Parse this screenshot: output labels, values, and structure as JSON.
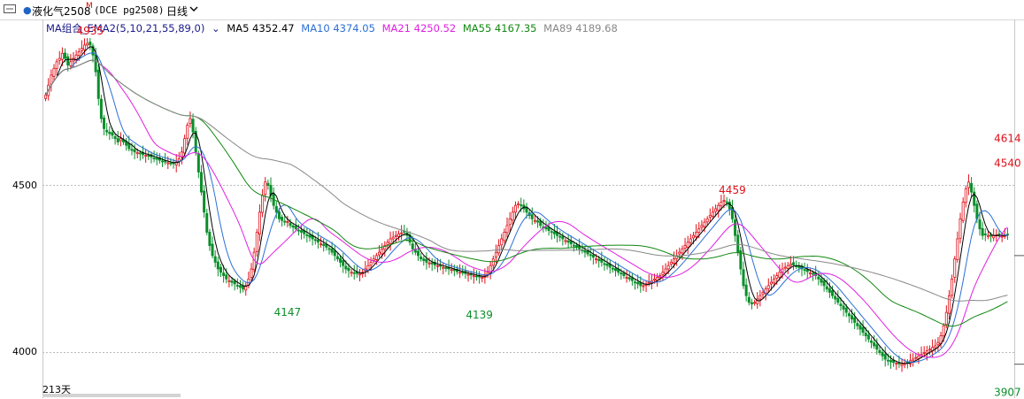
{
  "topbar": {
    "symbol": "液化气2508",
    "superscript": "M",
    "code": "(DCE pg2508)",
    "period": "日线"
  },
  "legend": {
    "name": "MA组合_EMA2(5,10,21,55,89,0)",
    "items": [
      {
        "label": "MA5 4352.47",
        "color": "#000000"
      },
      {
        "label": "MA10 4374.05",
        "color": "#2b6fd6"
      },
      {
        "label": "MA21 4250.52",
        "color": "#e11fe1"
      },
      {
        "label": "MA55 4167.35",
        "color": "#118811"
      },
      {
        "label": "MA89 4189.68",
        "color": "#888888"
      }
    ]
  },
  "footer": {
    "days": "213天"
  },
  "colors": {
    "up": "#e0101a",
    "down": "#0a8f2a",
    "grid": "#bbbbbb"
  },
  "chart_data": {
    "type": "candlestick",
    "ylim": [
      3890,
      4970
    ],
    "yticks": [
      4000,
      4500
    ],
    "annotations": [
      {
        "label": "4935",
        "i": 16,
        "value": 4935,
        "pos": "above",
        "color": "#e0101a"
      },
      {
        "label": "4147",
        "i": 87,
        "value": 4147,
        "pos": "below",
        "color": "#0a8f2a"
      },
      {
        "label": "4139",
        "i": 156,
        "value": 4139,
        "pos": "below",
        "color": "#0a8f2a"
      },
      {
        "label": "4459",
        "i": 247,
        "value": 4459,
        "pos": "above",
        "color": "#e0101a"
      },
      {
        "label": "4540",
        "i": 353,
        "value": 4540,
        "pos": "above",
        "color": "#e0101a"
      },
      {
        "label": "4614",
        "i": 465,
        "value": 4614,
        "pos": "above",
        "color": "#e0101a"
      },
      {
        "label": "3907",
        "i": 430,
        "value": 3907,
        "pos": "below",
        "color": "#0a8f2a"
      }
    ],
    "closes": [
      4770,
      4800,
      4830,
      4850,
      4870,
      4880,
      4895,
      4880,
      4860,
      4870,
      4880,
      4890,
      4900,
      4910,
      4920,
      4925,
      4920,
      4890,
      4840,
      4760,
      4700,
      4670,
      4660,
      4655,
      4650,
      4640,
      4630,
      4640,
      4630,
      4620,
      4610,
      4605,
      4600,
      4598,
      4595,
      4592,
      4590,
      4588,
      4585,
      4580,
      4578,
      4575,
      4572,
      4570,
      4568,
      4566,
      4565,
      4570,
      4580,
      4600,
      4640,
      4680,
      4700,
      4660,
      4600,
      4540,
      4480,
      4420,
      4360,
      4320,
      4290,
      4270,
      4250,
      4240,
      4230,
      4220,
      4215,
      4210,
      4205,
      4200,
      4195,
      4190,
      4200,
      4220,
      4250,
      4300,
      4360,
      4420,
      4470,
      4510,
      4500,
      4470,
      4440,
      4420,
      4400,
      4395,
      4390,
      4392,
      4380,
      4375,
      4370,
      4365,
      4360,
      4355,
      4350,
      4345,
      4340,
      4335,
      4330,
      4325,
      4320,
      4315,
      4310,
      4300,
      4290,
      4280,
      4270,
      4260,
      4250,
      4245,
      4240,
      4238,
      4236,
      4235,
      4240,
      4250,
      4260,
      4270,
      4280,
      4290,
      4300,
      4310,
      4320,
      4330,
      4340,
      4345,
      4350,
      4355,
      4358,
      4360,
      4350,
      4330,
      4310,
      4300,
      4290,
      4280,
      4275,
      4270,
      4268,
      4265,
      4262,
      4260,
      4258,
      4255,
      4252,
      4250,
      4248,
      4245,
      4242,
      4240,
      4238,
      4236,
      4234,
      4232,
      4230,
      4228,
      4226,
      4225,
      4230,
      4240,
      4260,
      4280,
      4300,
      4320,
      4340,
      4360,
      4380,
      4400,
      4420,
      4440,
      4445,
      4440,
      4430,
      4420,
      4410,
      4400,
      4395,
      4390,
      4380,
      4375,
      4370,
      4365,
      4360,
      4355,
      4350,
      4345,
      4340,
      4335,
      4330,
      4325,
      4320,
      4315,
      4310,
      4305,
      4300,
      4295,
      4290,
      4285,
      4280,
      4275,
      4270,
      4265,
      4260,
      4255,
      4250,
      4245,
      4240,
      4235,
      4230,
      4225,
      4220,
      4215,
      4210,
      4205,
      4200,
      4200,
      4205,
      4210,
      4215,
      4220,
      4225,
      4230,
      4240,
      4250,
      4260,
      4270,
      4280,
      4290,
      4300,
      4310,
      4320,
      4330,
      4340,
      4350,
      4360,
      4370,
      4380,
      4390,
      4400,
      4410,
      4420,
      4430,
      4440,
      4450,
      4455,
      4450,
      4430,
      4400,
      4350,
      4300,
      4250,
      4200,
      4170,
      4150,
      4145,
      4150,
      4160,
      4170,
      4180,
      4190,
      4200,
      4210,
      4220,
      4230,
      4240,
      4250,
      4255,
      4260,
      4265,
      4262,
      4258,
      4254,
      4250,
      4246,
      4242,
      4238,
      4234,
      4230,
      4220,
      4210,
      4200,
      4190,
      4180,
      4170,
      4160,
      4150,
      4140,
      4130,
      4120,
      4110,
      4100,
      4090,
      4080,
      4070,
      4060,
      4050,
      4040,
      4030,
      4020,
      4010,
      4000,
      3990,
      3980,
      3975,
      3972,
      3970,
      3968,
      3966,
      3965,
      3968,
      3970,
      3975,
      3980,
      3985,
      3990,
      3995,
      4000,
      4005,
      4010,
      4015,
      4020,
      4030,
      4050,
      4080,
      4120,
      4170,
      4220,
      4280,
      4340,
      4400,
      4450,
      4490,
      4510,
      4480,
      4440,
      4400,
      4370,
      4350,
      4352,
      4350,
      4348,
      4350,
      4352,
      4350,
      4348,
      4350,
      4352
    ],
    "series": [
      {
        "name": "MA5"
      },
      {
        "name": "MA10"
      },
      {
        "name": "MA21"
      },
      {
        "name": "MA55"
      },
      {
        "name": "MA89"
      }
    ]
  }
}
